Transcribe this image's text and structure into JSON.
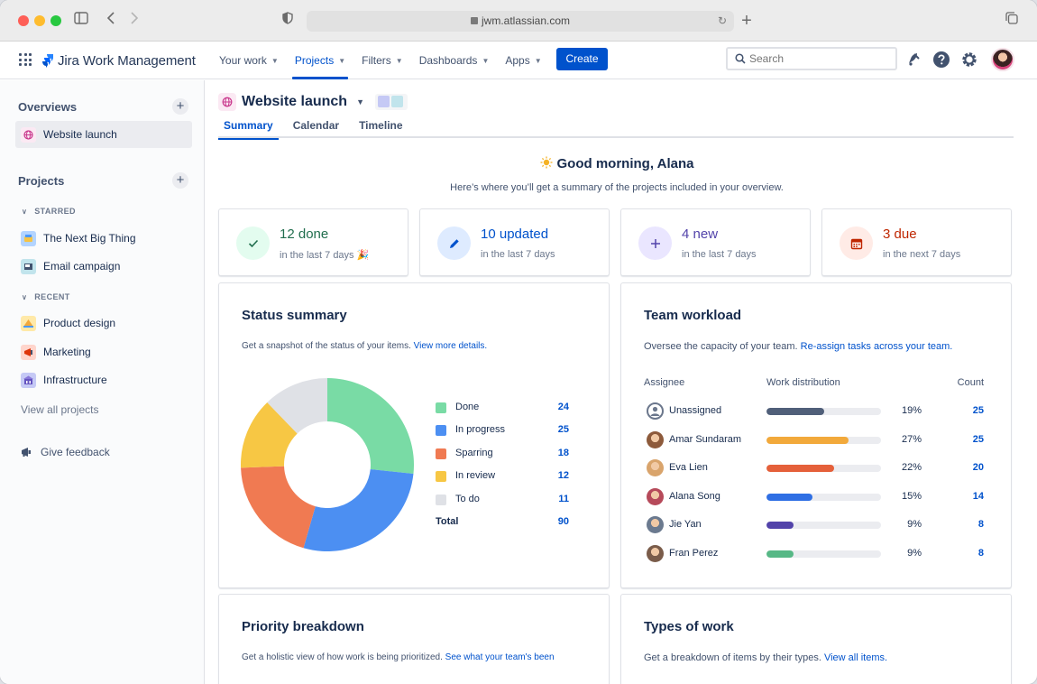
{
  "browser": {
    "url": "jwm.atlassian.com"
  },
  "app": {
    "name": "Jira Work Management",
    "nav": [
      {
        "label": "Your work",
        "active": false
      },
      {
        "label": "Projects",
        "active": true
      },
      {
        "label": "Filters",
        "active": false
      },
      {
        "label": "Dashboards",
        "active": false
      },
      {
        "label": "Apps",
        "active": false
      }
    ],
    "create_label": "Create",
    "search_placeholder": "Search"
  },
  "sidebar": {
    "overviews_heading": "Overviews",
    "overview_item": "Website launch",
    "projects_heading": "Projects",
    "starred_label": "STARRED",
    "starred": [
      {
        "label": "The Next Big Thing",
        "color": "#b3d4ff"
      },
      {
        "label": "Email campaign",
        "color": "#c1e4ec"
      }
    ],
    "recent_label": "RECENT",
    "recent": [
      {
        "label": "Product design",
        "color": "#ffe9a8"
      },
      {
        "label": "Marketing",
        "color": "#ffd5cc"
      },
      {
        "label": "Infrastructure",
        "color": "#c5c9f5"
      }
    ],
    "view_all": "View all projects",
    "feedback": "Give feedback"
  },
  "project": {
    "title": "Website launch",
    "tabs": [
      {
        "label": "Summary",
        "active": true
      },
      {
        "label": "Calendar",
        "active": false
      },
      {
        "label": "Timeline",
        "active": false
      }
    ]
  },
  "greeting": {
    "title": "Good morning, Alana",
    "subtitle": "Here’s where you’ll get a summary of the projects included in your overview."
  },
  "stats": [
    {
      "value": "12 done",
      "sub": "in the last 7 days",
      "emoji": "🎉",
      "color": "#216e4e",
      "bg": "#e3fcef",
      "icon": "check-icon"
    },
    {
      "value": "10 updated",
      "sub": "in the last 7 days",
      "emoji": "",
      "color": "#0052cc",
      "bg": "#deebff",
      "icon": "pencil-icon"
    },
    {
      "value": "4 new",
      "sub": "in the last 7 days",
      "emoji": "",
      "color": "#5243aa",
      "bg": "#eae6ff",
      "icon": "plus-icon"
    },
    {
      "value": "3 due",
      "sub": "in the next 7 days",
      "emoji": "",
      "color": "#bf2600",
      "bg": "#ffebe6",
      "icon": "calendar-icon"
    }
  ],
  "status_summary": {
    "title": "Status summary",
    "desc": "Get a snapshot of the status of your items. ",
    "link": "View more details.",
    "total_label": "Total",
    "total": "90"
  },
  "chart_data": {
    "type": "pie",
    "categories": [
      "Done",
      "In progress",
      "Sparring",
      "In review",
      "To do"
    ],
    "values": [
      24,
      25,
      18,
      12,
      11
    ],
    "colors": [
      "#79dba5",
      "#4c8ff2",
      "#f07a52",
      "#f7c744",
      "#dfe1e6"
    ],
    "total": 90
  },
  "team_workload": {
    "title": "Team workload",
    "desc": "Oversee the capacity of your team. ",
    "link": "Re-assign tasks across your team.",
    "col_assignee": "Assignee",
    "col_distribution": "Work distribution",
    "col_count": "Count",
    "rows": [
      {
        "name": "Unassigned",
        "pct": "19%",
        "value": 19,
        "count": "25",
        "color": "#505f79"
      },
      {
        "name": "Amar Sundaram",
        "pct": "27%",
        "value": 27,
        "count": "25",
        "color": "#f2a93b"
      },
      {
        "name": "Eva Lien",
        "pct": "22%",
        "value": 22,
        "count": "20",
        "color": "#e5603a"
      },
      {
        "name": "Alana Song",
        "pct": "15%",
        "value": 15,
        "count": "14",
        "color": "#2f6fe4"
      },
      {
        "name": "Jie Yan",
        "pct": "9%",
        "value": 9,
        "count": "8",
        "color": "#5243aa"
      },
      {
        "name": "Fran Perez",
        "pct": "9%",
        "value": 9,
        "count": "8",
        "color": "#57b886"
      }
    ]
  },
  "priority": {
    "title": "Priority breakdown",
    "desc": "Get a holistic view of how work is being prioritized. ",
    "link": "See what your team's been"
  },
  "types": {
    "title": "Types of work",
    "desc": "Get a breakdown of items by their types. ",
    "link": "View all items."
  }
}
